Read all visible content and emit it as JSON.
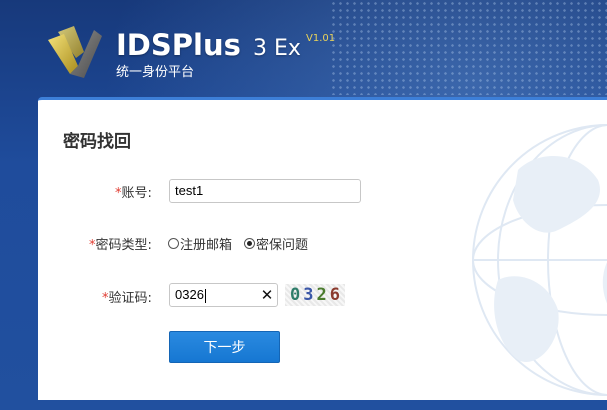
{
  "header": {
    "brand": "IDSPlus",
    "edition": "3 Ex",
    "version": "V1.01",
    "subtitle": "统一身份平台"
  },
  "panel": {
    "title": "密码找回"
  },
  "form": {
    "required_mark": "*",
    "account_label": "账号:",
    "account_value": "test1",
    "type_label": "密码类型:",
    "type_options": [
      {
        "label": "注册邮箱",
        "checked": false
      },
      {
        "label": "密保问题",
        "checked": true
      }
    ],
    "captcha_label": "验证码:",
    "captcha_value": "0326",
    "captcha_clear_icon": "close-icon",
    "captcha_image_text": [
      "0",
      "3",
      "2",
      "6"
    ],
    "captcha_image_colors": [
      "#2e7d6a",
      "#3b57a8",
      "#4c7c2f",
      "#8b3a2e"
    ],
    "next_button": "下一步"
  }
}
